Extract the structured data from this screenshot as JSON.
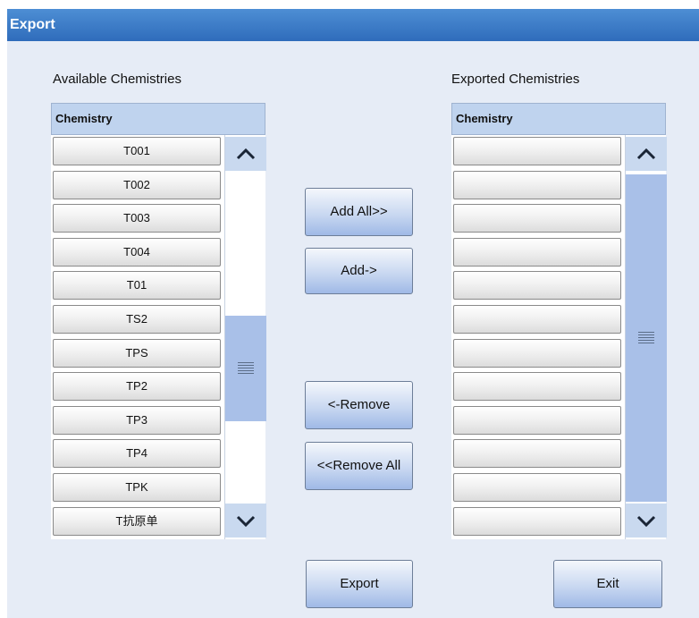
{
  "window": {
    "title": "Export"
  },
  "available": {
    "label": "Available Chemistries",
    "header": "Chemistry",
    "items": [
      "T001",
      "T002",
      "T003",
      "T004",
      "T01",
      "TS2",
      "TPS",
      "TP2",
      "TP3",
      "TP4",
      "TPK",
      "T抗原单"
    ]
  },
  "exported": {
    "label": "Exported Chemistries",
    "header": "Chemistry",
    "items": [
      "",
      "",
      "",
      "",
      "",
      "",
      "",
      "",
      "",
      "",
      "",
      ""
    ]
  },
  "actions": {
    "add_all": "Add All>>",
    "add": "Add->",
    "remove": "<-Remove",
    "remove_all": "<<Remove All",
    "export": "Export",
    "exit": "Exit"
  },
  "icons": {
    "scroll_up": "chevron-up-icon",
    "scroll_down": "chevron-down-icon",
    "grip": "scroll-grip-icon"
  },
  "colors": {
    "titlebar": "#3a7bc8",
    "background": "#e6ecf6",
    "scroll_thumb": "#a9c0e8"
  }
}
